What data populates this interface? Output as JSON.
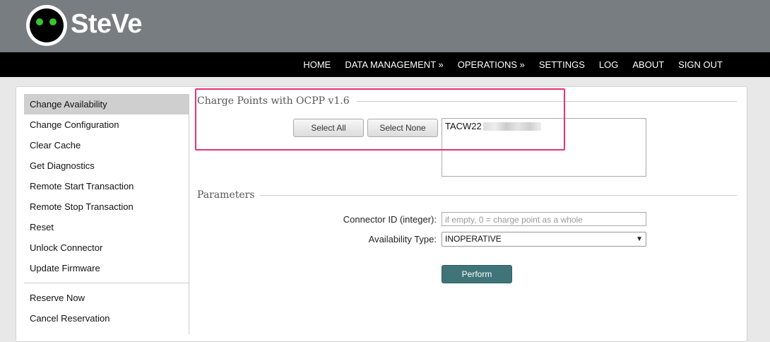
{
  "app": {
    "name": "SteVe"
  },
  "nav": {
    "items": [
      {
        "label": "HOME"
      },
      {
        "label": "DATA MANAGEMENT »"
      },
      {
        "label": "OPERATIONS »"
      },
      {
        "label": "SETTINGS"
      },
      {
        "label": "LOG"
      },
      {
        "label": "ABOUT"
      },
      {
        "label": "SIGN OUT"
      }
    ]
  },
  "sidebar": {
    "items": [
      {
        "label": "Change Availability",
        "active": true
      },
      {
        "label": "Change Configuration"
      },
      {
        "label": "Clear Cache"
      },
      {
        "label": "Get Diagnostics"
      },
      {
        "label": "Remote Start Transaction"
      },
      {
        "label": "Remote Stop Transaction"
      },
      {
        "label": "Reset"
      },
      {
        "label": "Unlock Connector"
      },
      {
        "label": "Update Firmware"
      }
    ],
    "items2": [
      {
        "label": "Reserve Now"
      },
      {
        "label": "Cancel Reservation"
      }
    ]
  },
  "charge_points": {
    "title": "Charge Points with OCPP v1.6",
    "select_all": "Select All",
    "select_none": "Select None",
    "options": [
      "TACW22"
    ]
  },
  "parameters": {
    "title": "Parameters",
    "connector_label": "Connector ID (integer):",
    "connector_placeholder": "if empty, 0 = charge point as a whole",
    "availability_label": "Availability Type:",
    "availability_value": "INOPERATIVE",
    "perform": "Perform"
  },
  "colors": {
    "header_bg": "#777d80",
    "nav_bg": "#000000",
    "perform_bg": "#3f7479",
    "highlight": "#e8336f",
    "logo_eye": "#38c530"
  }
}
